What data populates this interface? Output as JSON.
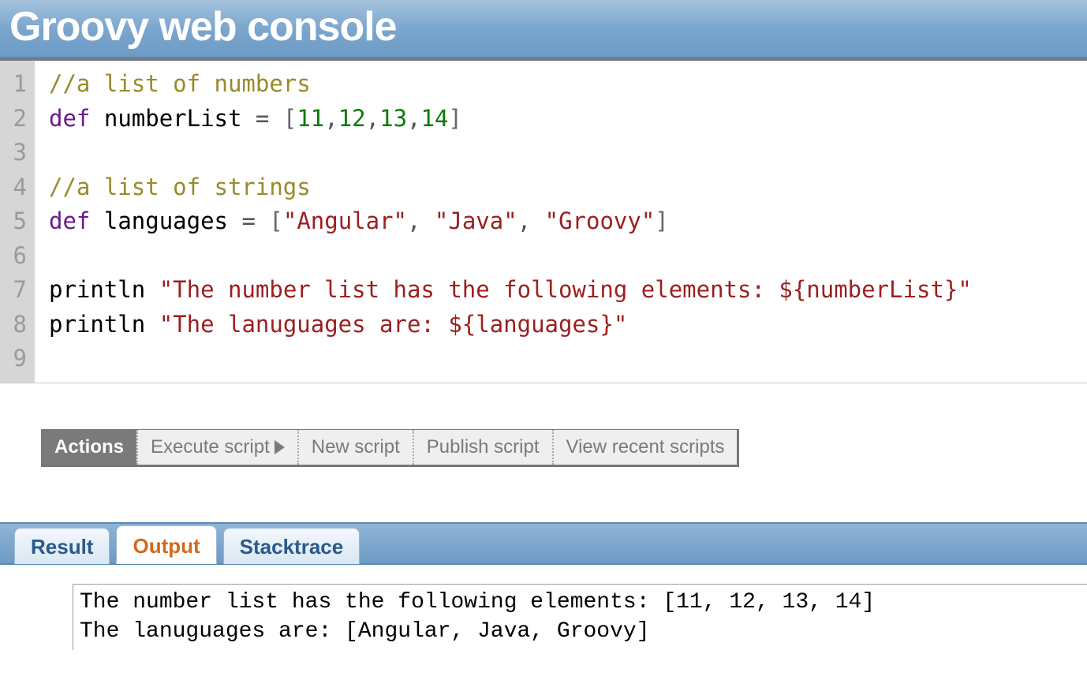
{
  "header": {
    "title": "Groovy web console"
  },
  "editor": {
    "line_numbers": [
      "1",
      "2",
      "3",
      "4",
      "5",
      "6",
      "7",
      "8",
      "9"
    ],
    "code": {
      "l1": {
        "comment": "//a list of numbers"
      },
      "l2": {
        "kw": "def",
        "ident": "numberList",
        "eq": " = ",
        "lb": "[",
        "n1": "11",
        "c1": ",",
        "n2": "12",
        "c2": ",",
        "n3": "13",
        "c3": ",",
        "n4": "14",
        "rb": "]"
      },
      "l4": {
        "comment": "//a list of strings"
      },
      "l5": {
        "kw": "def",
        "ident": "languages",
        "eq": " = ",
        "lb": "[",
        "s1": "\"Angular\"",
        "c1": ", ",
        "s2": "\"Java\"",
        "c2": ", ",
        "s3": "\"Groovy\"",
        "rb": "]"
      },
      "l7": {
        "ident": "println",
        "sp": " ",
        "str": "\"The number list has the following elements: ${numberList}\""
      },
      "l8": {
        "ident": "println",
        "sp": " ",
        "str": "\"The lanuguages are: ${languages}\""
      }
    }
  },
  "actions": {
    "label": "Actions",
    "execute": "Execute script",
    "new": "New script",
    "publish": "Publish script",
    "recent": "View recent scripts"
  },
  "tabs": {
    "result": "Result",
    "output": "Output",
    "stacktrace": "Stacktrace"
  },
  "output": {
    "text": "The number list has the following elements: [11, 12, 13, 14]\nThe lanuguages are: [Angular, Java, Groovy]"
  }
}
